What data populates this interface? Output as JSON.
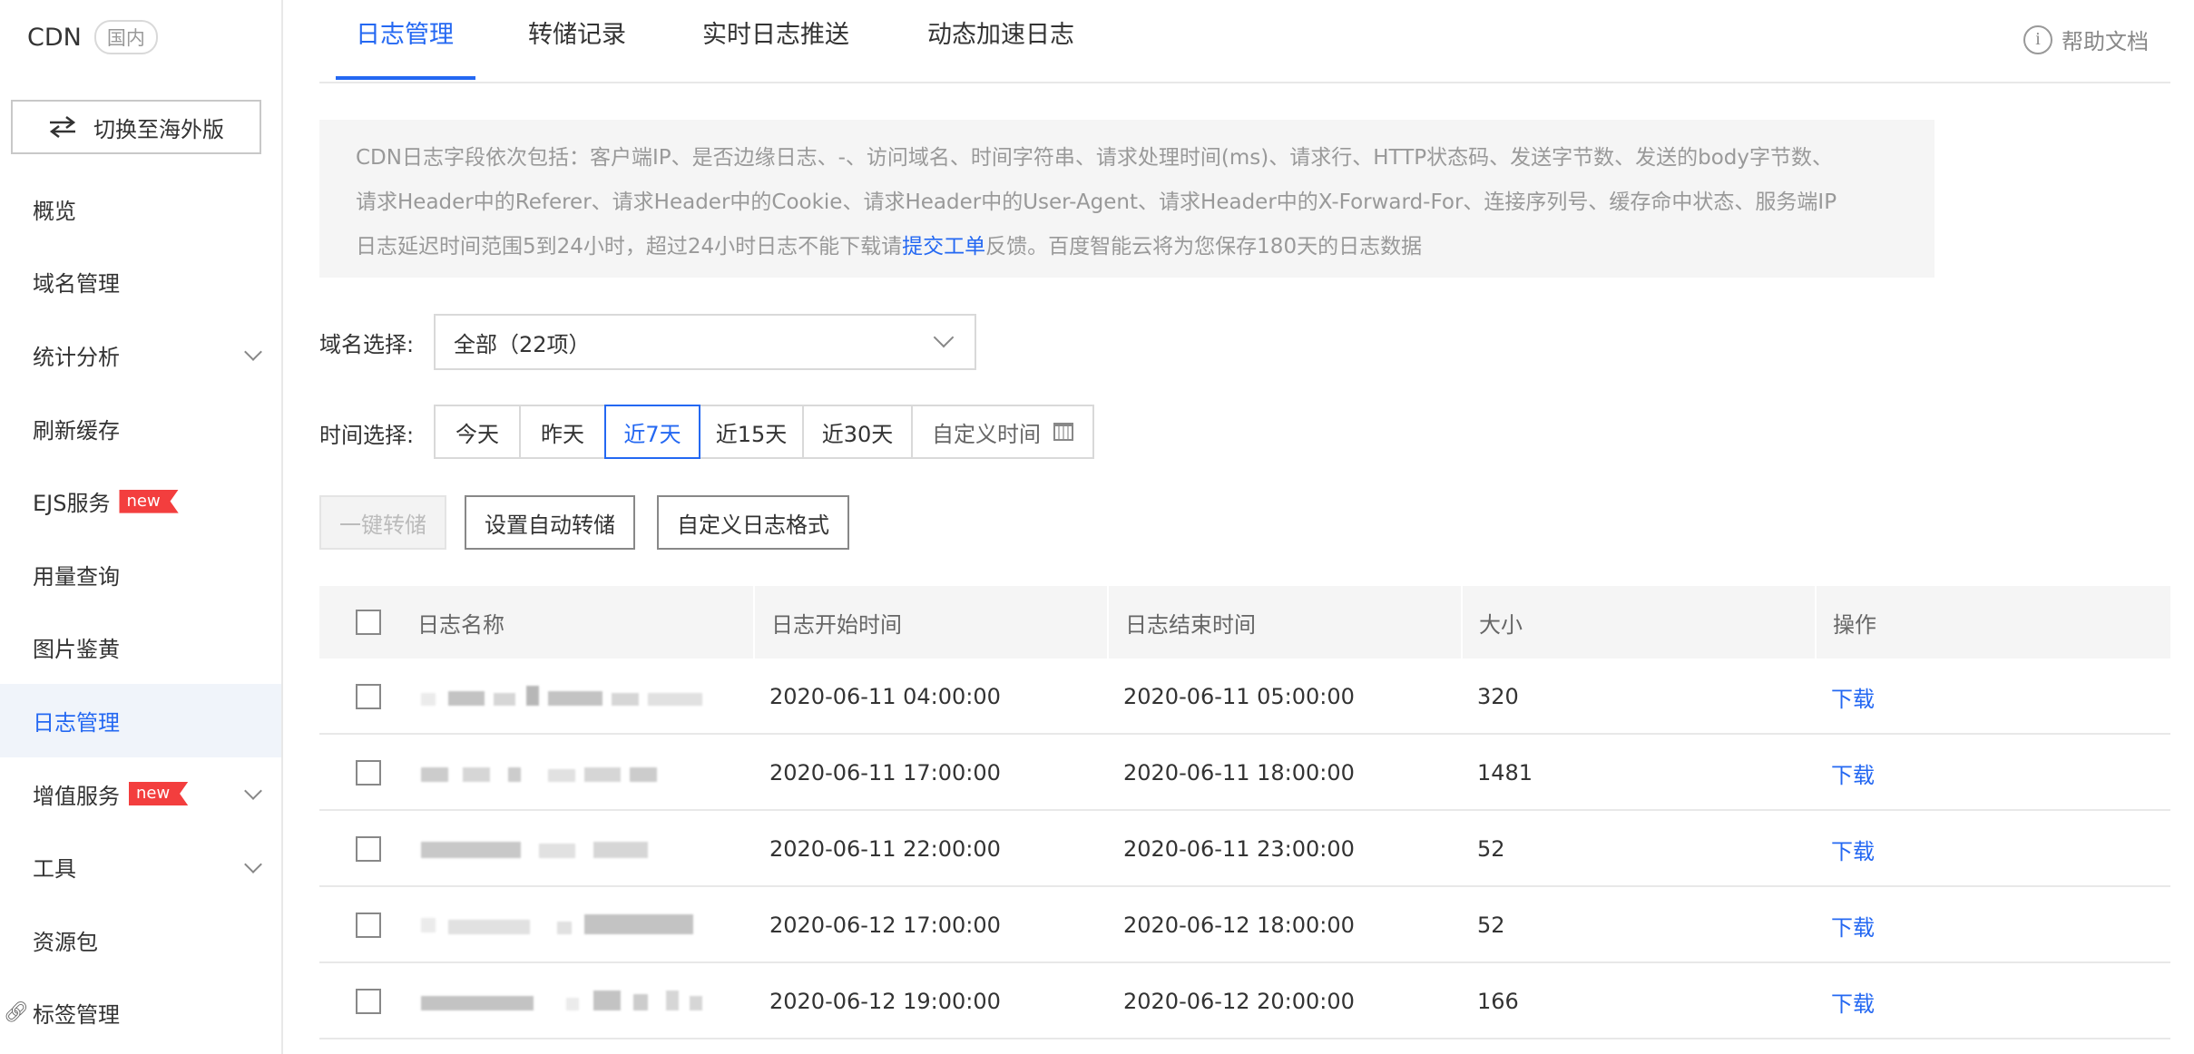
{
  "brand": {
    "name": "CDN",
    "region": "国内"
  },
  "sidebar": {
    "switch_label": "切换至海外版",
    "items": [
      {
        "label": "概览"
      },
      {
        "label": "域名管理"
      },
      {
        "label": "统计分析"
      },
      {
        "label": "刷新缓存"
      },
      {
        "label": "EJS服务",
        "badge": "new"
      },
      {
        "label": "用量查询"
      },
      {
        "label": "图片鉴黄"
      },
      {
        "label": "日志管理"
      },
      {
        "label": "增值服务",
        "badge": "new"
      },
      {
        "label": "工具"
      },
      {
        "label": "资源包"
      },
      {
        "label": "标签管理"
      }
    ]
  },
  "tabs": [
    "日志管理",
    "转储记录",
    "实时日志推送",
    "动态加速日志"
  ],
  "help": "帮助文档",
  "info": {
    "line1": "CDN日志字段依次包括：客户端IP、是否边缘日志、-、访问域名、时间字符串、请求处理时间(ms)、请求行、HTTP状态码、发送字节数、发送的body字节数、",
    "line2": "请求Header中的Referer、请求Header中的Cookie、请求Header中的User-Agent、请求Header中的X-Forward-For、连接序列号、缓存命中状态、服务端IP",
    "line3_prefix": "日志延迟时间范围5到24小时，超过24小时日志不能下载请",
    "line3_link": "提交工单",
    "line3_suffix": "反馈。百度智能云将为您保存180天的日志数据"
  },
  "filters": {
    "domain_label": "域名选择:",
    "domain_value": "全部（22项）",
    "time_label": "时间选择:",
    "time_options": [
      "今天",
      "昨天",
      "近7天",
      "近15天",
      "近30天",
      "自定义时间"
    ]
  },
  "actions": {
    "one_click": "一键转储",
    "auto_dump": "设置自动转储",
    "custom_format": "自定义日志格式"
  },
  "table": {
    "headers": [
      "日志名称",
      "日志开始时间",
      "日志结束时间",
      "大小",
      "操作"
    ],
    "rows": [
      {
        "start": "2020-06-11 04:00:00",
        "end": "2020-06-11 05:00:00",
        "size": "320",
        "action": "下载"
      },
      {
        "start": "2020-06-11 17:00:00",
        "end": "2020-06-11 18:00:00",
        "size": "1481",
        "action": "下载"
      },
      {
        "start": "2020-06-11 22:00:00",
        "end": "2020-06-11 23:00:00",
        "size": "52",
        "action": "下载"
      },
      {
        "start": "2020-06-12 17:00:00",
        "end": "2020-06-12 18:00:00",
        "size": "52",
        "action": "下载"
      },
      {
        "start": "2020-06-12 19:00:00",
        "end": "2020-06-12 20:00:00",
        "size": "166",
        "action": "下载"
      }
    ]
  },
  "colors": {
    "accent": "#2468f2",
    "badge": "#f33e3e"
  }
}
